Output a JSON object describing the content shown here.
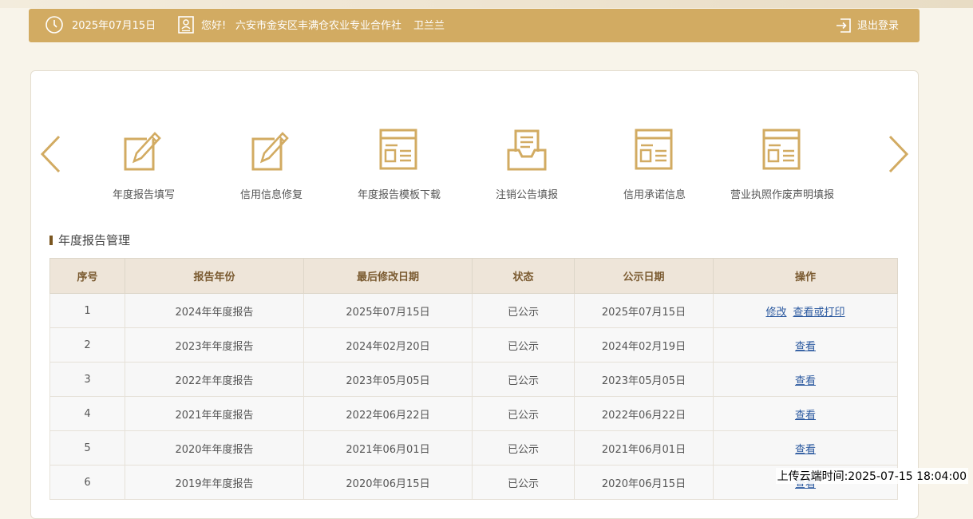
{
  "header": {
    "date": "2025年07月15日",
    "greeting": "您好!",
    "org_name": "六安市金安区丰满仓农业专业合作社",
    "user_name": "卫兰兰",
    "logout_label": "退出登录"
  },
  "colors": {
    "header_bg": "#d2ab62",
    "icon_gold": "#d2ab62",
    "link_blue": "#2c5aa0",
    "table_header_bg": "#eee5d9"
  },
  "features": [
    {
      "label": "年度报告填写",
      "icon": "edit-icon"
    },
    {
      "label": "信用信息修复",
      "icon": "edit-icon"
    },
    {
      "label": "年度报告模板下载",
      "icon": "template-icon"
    },
    {
      "label": "注销公告填报",
      "icon": "inbox-document-icon"
    },
    {
      "label": "信用承诺信息",
      "icon": "template-icon"
    },
    {
      "label": "营业执照作废声明填报",
      "icon": "template-icon"
    }
  ],
  "section": {
    "title": "年度报告管理"
  },
  "table": {
    "headers": [
      "序号",
      "报告年份",
      "最后修改日期",
      "状态",
      "公示日期",
      "操作"
    ],
    "rows": [
      {
        "no": "1",
        "year": "2024年年度报告",
        "modified": "2025年07月15日",
        "status": "已公示",
        "published": "2025年07月15日",
        "actions": [
          "修改",
          "查看或打印"
        ]
      },
      {
        "no": "2",
        "year": "2023年年度报告",
        "modified": "2024年02月20日",
        "status": "已公示",
        "published": "2024年02月19日",
        "actions": [
          "查看"
        ]
      },
      {
        "no": "3",
        "year": "2022年年度报告",
        "modified": "2023年05月05日",
        "status": "已公示",
        "published": "2023年05月05日",
        "actions": [
          "查看"
        ]
      },
      {
        "no": "4",
        "year": "2021年年度报告",
        "modified": "2022年06月22日",
        "status": "已公示",
        "published": "2022年06月22日",
        "actions": [
          "查看"
        ]
      },
      {
        "no": "5",
        "year": "2020年年度报告",
        "modified": "2021年06月01日",
        "status": "已公示",
        "published": "2021年06月01日",
        "actions": [
          "查看"
        ]
      },
      {
        "no": "6",
        "year": "2019年年度报告",
        "modified": "2020年06月15日",
        "status": "已公示",
        "published": "2020年06月15日",
        "actions": [
          "查看"
        ]
      }
    ]
  },
  "watermark": "上传云端时间:2025-07-15 18:04:00"
}
